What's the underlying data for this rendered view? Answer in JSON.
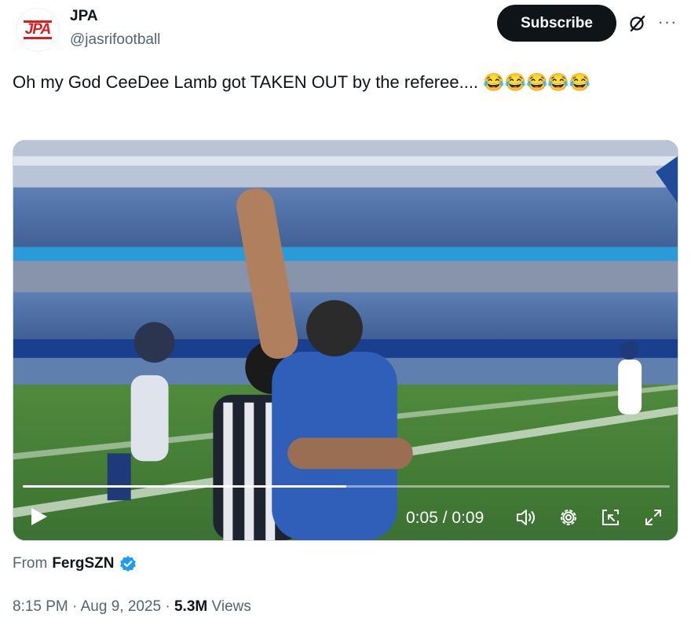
{
  "account": {
    "name": "JPA",
    "handle": "@jasrifootball",
    "avatar_text": "JPA"
  },
  "subscribe_label": "Subscribe",
  "tweet": {
    "text": "Oh my God CeeDee Lamb got TAKEN OUT by the referee.... ",
    "emojis": "😂😂😂😂😂"
  },
  "video": {
    "progress_fraction": 0.5,
    "current_time": "0:05",
    "separator": " / ",
    "duration": "0:09",
    "icons": [
      "play-icon",
      "volume-icon",
      "settings-icon",
      "dock-icon",
      "fullscreen-icon"
    ]
  },
  "attribution": {
    "prefix": "From",
    "source": "FergSZN"
  },
  "meta": {
    "time": "8:15 PM",
    "dot1": " · ",
    "date": "Aug 9, 2025",
    "dot2": " · ",
    "views_count": "5.3M",
    "views_label": " Views"
  },
  "colors": {
    "text": "#0f1419",
    "secondary": "#536471",
    "verified": "#1d9bf0",
    "button": "#0f1419"
  }
}
